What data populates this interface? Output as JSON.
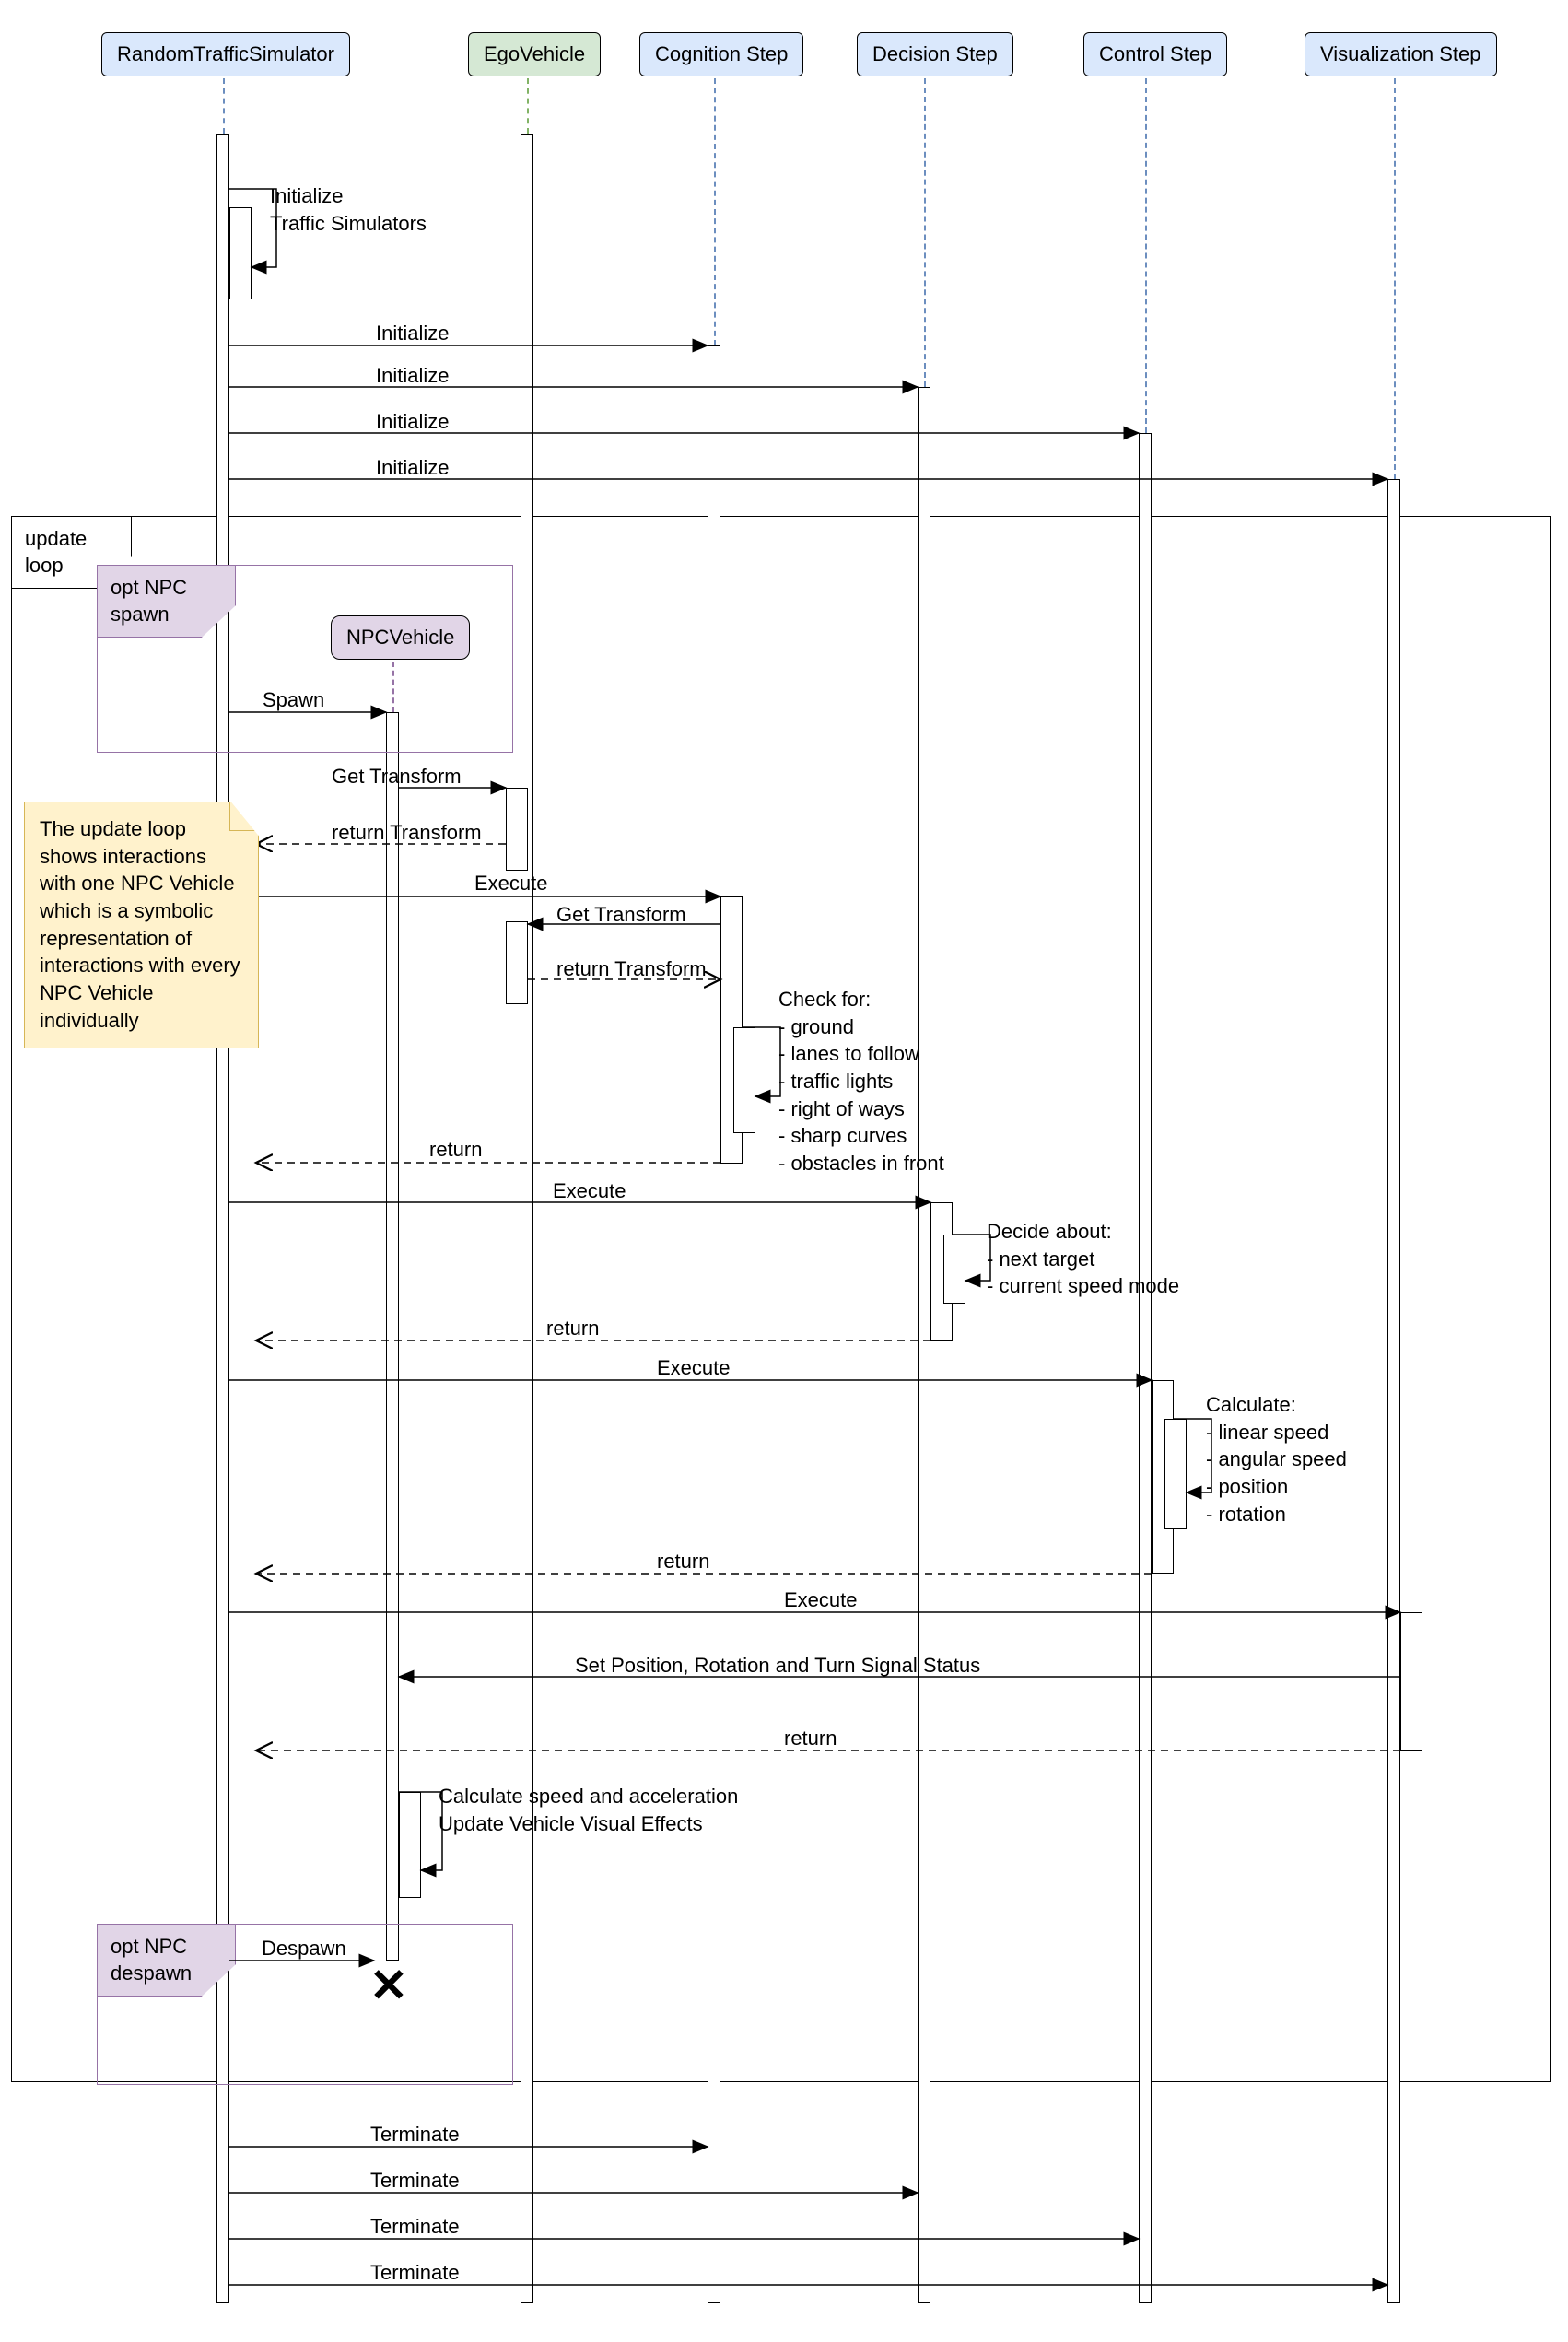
{
  "participants": {
    "rts": "RandomTrafficSimulator",
    "ego": "EgoVehicle",
    "cog": "Cognition Step",
    "dec": "Decision Step",
    "ctrl": "Control Step",
    "viz": "Visualization Step",
    "npc": "NPCVehicle"
  },
  "frames": {
    "loop": "update\nloop",
    "opt_spawn": "opt NPC\nspawn",
    "opt_despawn": "opt NPC\ndespawn"
  },
  "note_text": "The update loop\nshows interactions\nwith one NPC Vehicle\nwhich is a symbolic\nrepresentation of\ninteractions with\nevery NPC Vehicle\nindividually",
  "messages": {
    "init_self": "Initialize\nTraffic Simulators",
    "initialize": "Initialize",
    "spawn": "Spawn",
    "get_transform": "Get Transform",
    "return_transform": "return Transform",
    "execute": "Execute",
    "return": "return",
    "cog_self": "Check for:\n- ground\n- lanes to follow\n- traffic lights\n- right of ways\n- sharp curves\n- obstacles in front",
    "dec_self": "Decide about:\n- next target\n- current speed mode",
    "ctrl_self": "Calculate:\n- linear speed\n- angular speed\n- position\n- rotation",
    "viz_set": "Set Position, Rotation and Turn Signal Status",
    "npc_self": "Calculate speed and acceleration\nUpdate Vehicle Visual Effects",
    "despawn": "Despawn",
    "terminate": "Terminate"
  }
}
